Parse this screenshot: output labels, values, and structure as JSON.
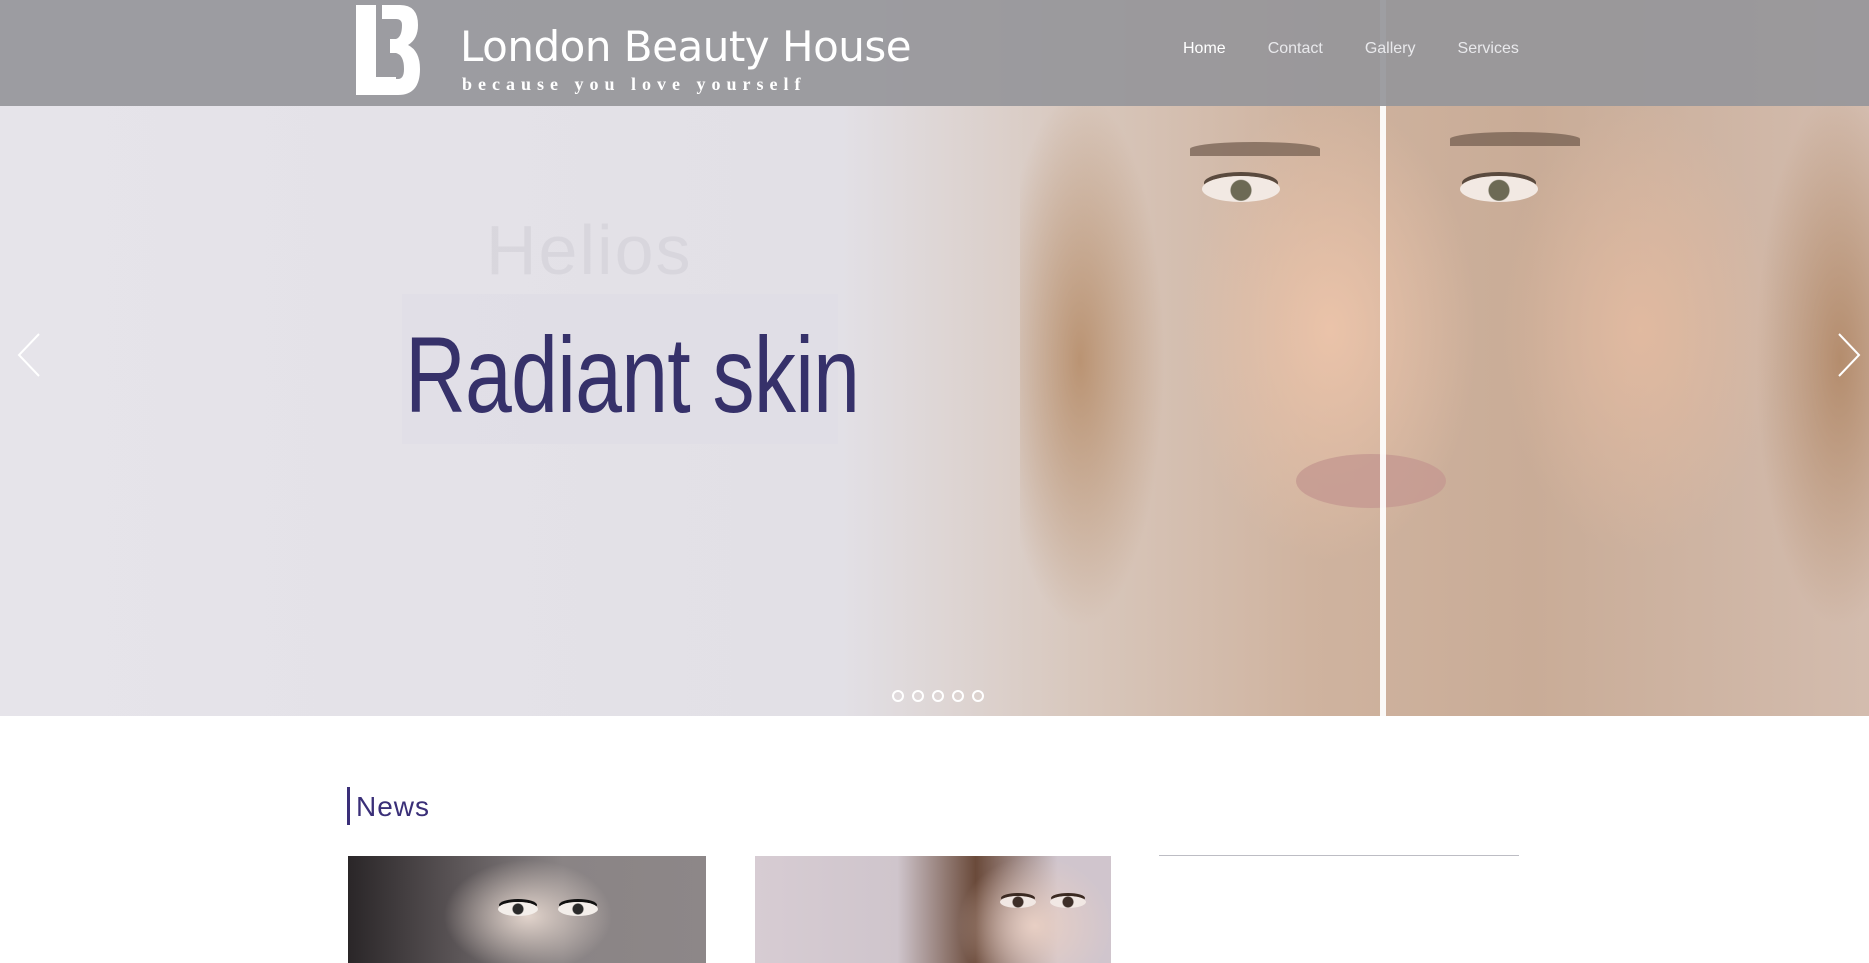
{
  "brand": {
    "logo_letters": "LB",
    "title": "London Beauty House",
    "tagline": "because you love yourself"
  },
  "nav": {
    "items": [
      {
        "label": "Home",
        "active": true
      },
      {
        "label": "Contact",
        "active": false
      },
      {
        "label": "Gallery",
        "active": false
      },
      {
        "label": "Services",
        "active": false
      }
    ]
  },
  "hero": {
    "headline": "Radiant skin",
    "ghost_text": "Helios",
    "slide_count": 5,
    "headline_color": "#36316a"
  },
  "news": {
    "title": "News",
    "accent_color": "#3a2f78"
  },
  "icons": {
    "prev": "chevron-left-icon",
    "next": "chevron-right-icon"
  }
}
